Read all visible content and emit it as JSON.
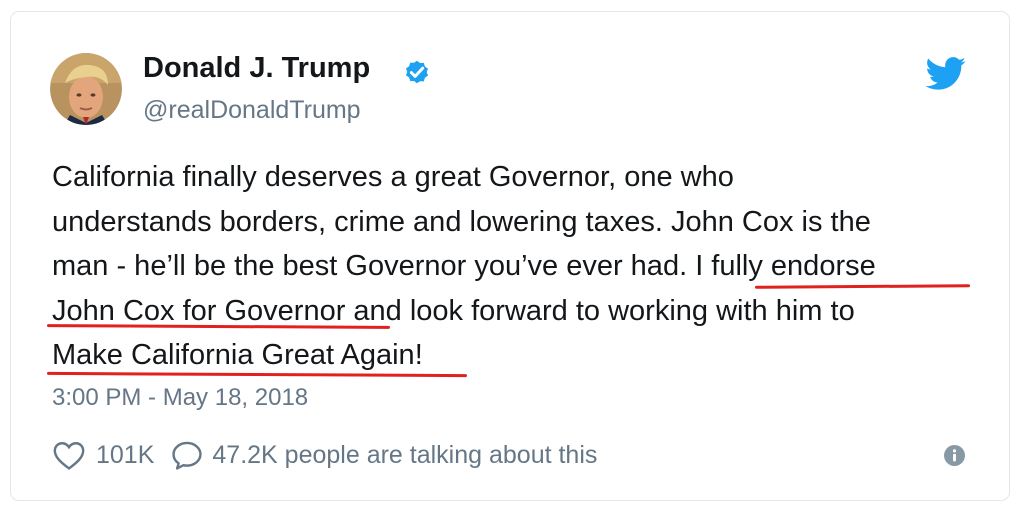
{
  "tweet": {
    "author": {
      "display_name": "Donald J. Trump",
      "handle": "@realDonaldTrump",
      "verified": true
    },
    "body_lines": [
      {
        "text": "California finally deserves a great Governor, one who"
      },
      {
        "text": "understands borders, crime and lowering taxes. John Cox is the"
      },
      {
        "pre": "man - he’ll be the best Governor you’ve ever had. ",
        "highlight": "I fully endorse"
      },
      {
        "highlight": "John Cox for Governor",
        "post": " and look forward to working with him to"
      },
      {
        "highlight": "Make California Great Again",
        "post": "!"
      }
    ],
    "timestamp": "3:00 PM - May 18, 2018",
    "likes": "101K",
    "conversation": "47.2K people are talking about this"
  },
  "colors": {
    "text": "#14171a",
    "secondary": "#657786",
    "twitter_blue": "#1da1f2",
    "highlight_underline": "#e0211d",
    "border": "#e1e8ed"
  },
  "icons": [
    "twitter-bird-icon",
    "verified-badge-icon",
    "heart-icon",
    "reply-bubble-icon",
    "info-icon"
  ]
}
